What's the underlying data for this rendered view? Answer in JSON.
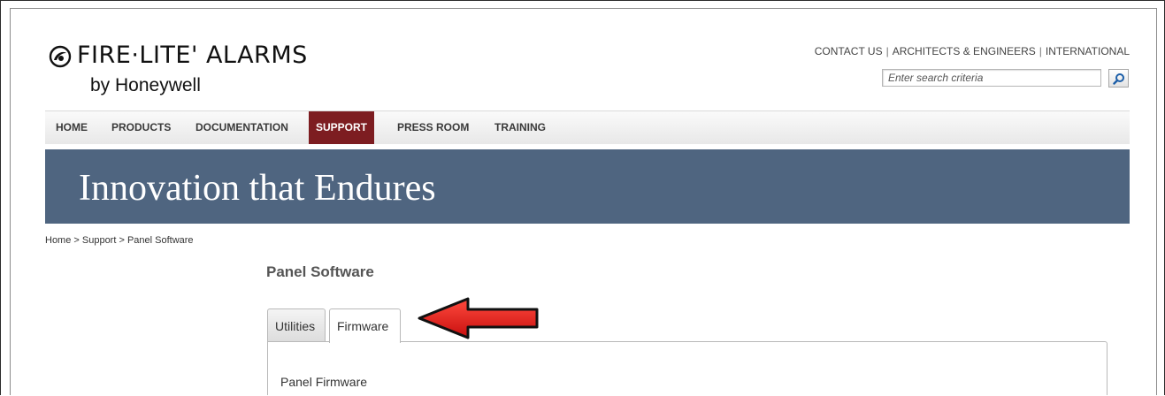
{
  "brand": {
    "name": "FIRE·LITE' ALARMS",
    "sub": "by Honeywell"
  },
  "utility_links": [
    "CONTACT US",
    "ARCHITECTS & ENGINEERS",
    "INTERNATIONAL"
  ],
  "search": {
    "placeholder": "Enter search criteria"
  },
  "nav": {
    "items": [
      {
        "label": "HOME"
      },
      {
        "label": "PRODUCTS"
      },
      {
        "label": "DOCUMENTATION"
      },
      {
        "label": "SUPPORT"
      },
      {
        "label": "PRESS ROOM"
      },
      {
        "label": "TRAINING"
      }
    ],
    "active": "SUPPORT"
  },
  "banner": {
    "text": "Innovation that Endures"
  },
  "breadcrumb": "Home > Support > Panel Software",
  "page_title": "Panel Software",
  "tabs": [
    {
      "label": "Utilities"
    },
    {
      "label": "Firmware"
    }
  ],
  "selected_tab": "Firmware",
  "panel": {
    "heading": "Panel Firmware"
  },
  "colors": {
    "banner": "#4f6580",
    "active_nav": "#7d1d21",
    "arrow": "#e31b1b"
  },
  "icons": [
    "fire-lite-logo-icon",
    "search-icon",
    "red-arrow-annotation"
  ]
}
